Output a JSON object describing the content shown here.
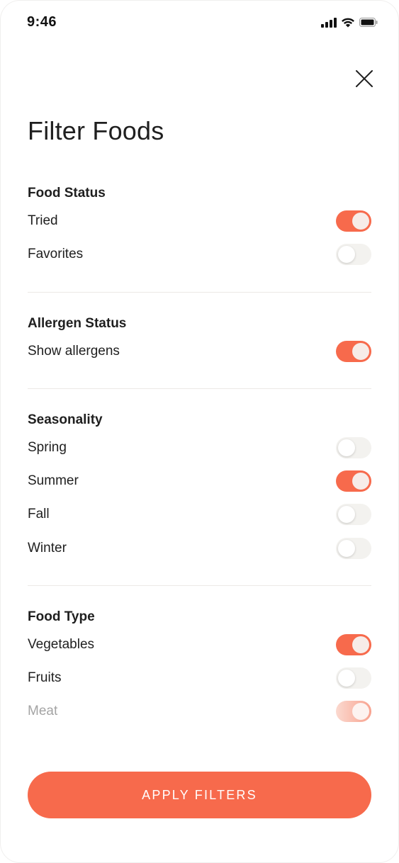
{
  "status_bar": {
    "time": "9:46"
  },
  "header": {
    "title": "Filter Foods"
  },
  "sections": [
    {
      "title": "Food Status",
      "items": [
        {
          "label": "Tried",
          "on": true
        },
        {
          "label": "Favorites",
          "on": false
        }
      ]
    },
    {
      "title": "Allergen Status",
      "items": [
        {
          "label": "Show allergens",
          "on": true
        }
      ]
    },
    {
      "title": "Seasonality",
      "items": [
        {
          "label": "Spring",
          "on": false
        },
        {
          "label": "Summer",
          "on": true
        },
        {
          "label": "Fall",
          "on": false
        },
        {
          "label": "Winter",
          "on": false
        }
      ]
    },
    {
      "title": "Food Type",
      "items": [
        {
          "label": "Vegetables",
          "on": true
        },
        {
          "label": "Fruits",
          "on": false
        },
        {
          "label": "Meat",
          "on": true,
          "disabled": true
        }
      ]
    }
  ],
  "footer": {
    "apply_label": "APPLY FILTERS"
  },
  "colors": {
    "accent": "#f76a4c",
    "toggle_off": "#f3f2ef",
    "text": "#1f1f1f",
    "muted_text": "#a4a4a4"
  },
  "icons": {
    "close": "close-icon",
    "signal": "cellular-signal-icon",
    "wifi": "wifi-icon",
    "battery": "battery-icon"
  }
}
